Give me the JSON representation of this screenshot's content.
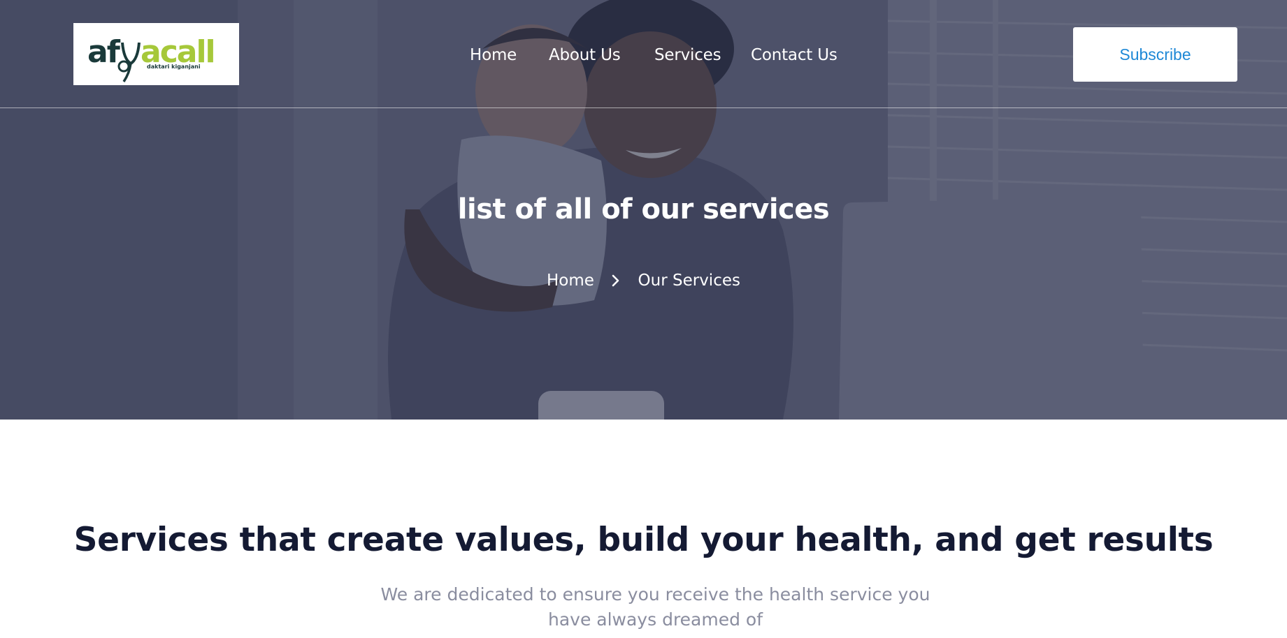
{
  "header": {
    "logo": {
      "brand_dark": "af",
      "brand_accent": "acall",
      "tagline": "daktari kiganjani",
      "colors": {
        "dark": "#1a3a3a",
        "accent": "#a6c83a"
      }
    },
    "nav": [
      {
        "label": "Home"
      },
      {
        "label": "About Us"
      },
      {
        "label": "Services"
      },
      {
        "label": "Contact Us"
      }
    ],
    "subscribe_label": "Subscribe"
  },
  "hero": {
    "title": "list of all of our services",
    "breadcrumb": {
      "home": "Home",
      "separator_icon": "chevron-right-icon",
      "current": "Our Services"
    },
    "overlay_color": "#282d4b"
  },
  "section": {
    "heading": "Services that create values, build your health, and get results",
    "subtitle": "We are dedicated to ensure you receive the health service you have always dreamed of"
  },
  "colors": {
    "subscribe_text": "#1e88d6",
    "heading_text": "#141a33",
    "subtitle_text": "#8a8d9f"
  }
}
